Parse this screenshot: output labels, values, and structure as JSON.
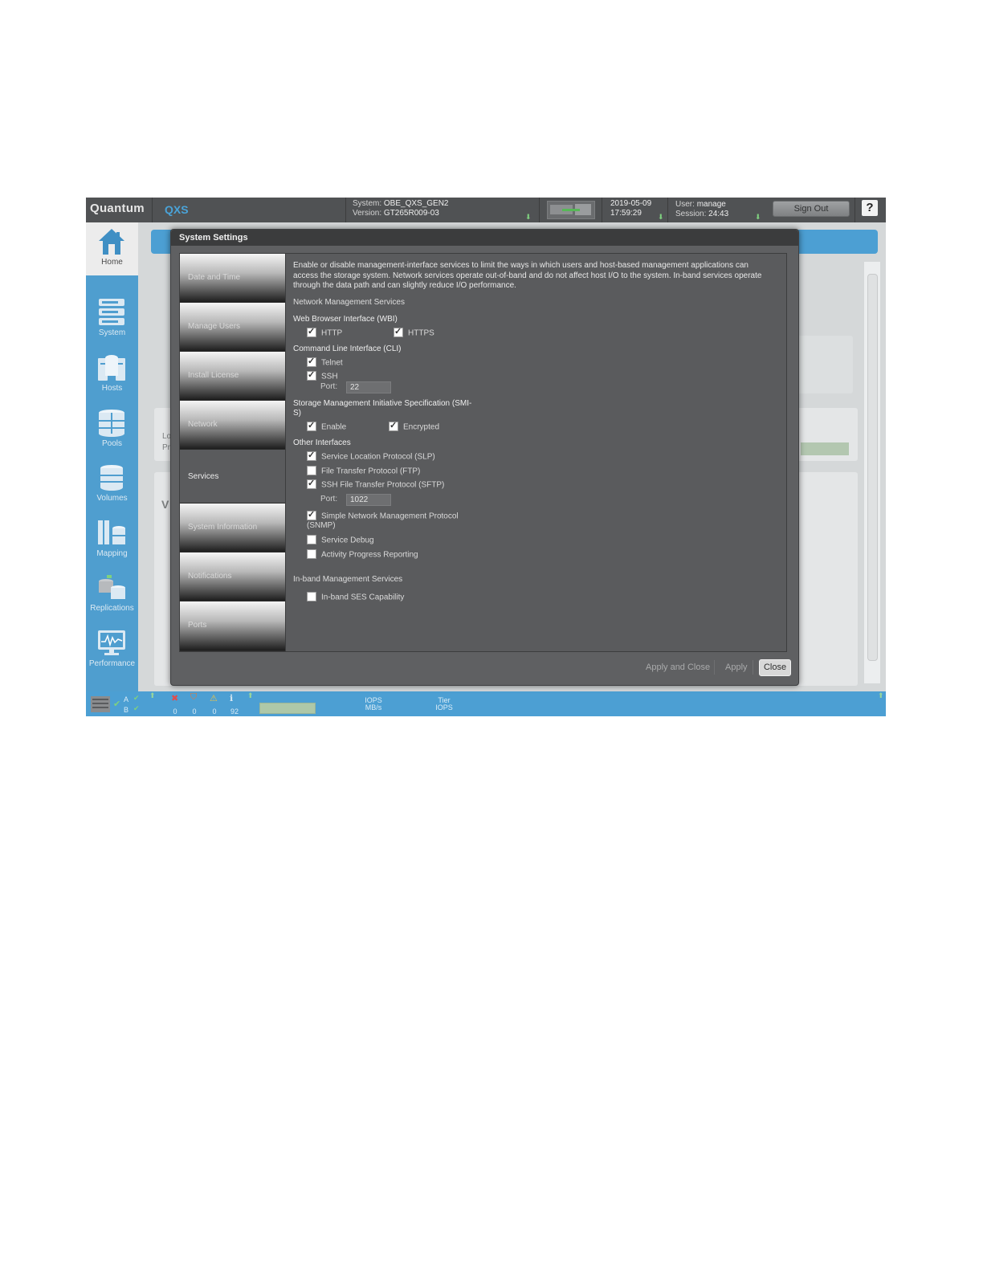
{
  "topbar": {
    "brand": "Quantum",
    "product": "QXS",
    "system_label": "System:",
    "system_name": "OBE_QXS_GEN2",
    "version_label": "Version:",
    "version": "GT265R009-03",
    "date": "2019-05-09",
    "time": "17:59:29",
    "user_label": "User:",
    "user": "manage",
    "session_label": "Session:",
    "session": "24:43",
    "sign_out": "Sign Out",
    "help": "?"
  },
  "sidenav": {
    "items": [
      {
        "label": "Home",
        "icon": "home-icon"
      },
      {
        "label": "System",
        "icon": "system-icon"
      },
      {
        "label": "Hosts",
        "icon": "hosts-icon"
      },
      {
        "label": "Pools",
        "icon": "pools-icon"
      },
      {
        "label": "Volumes",
        "icon": "volumes-icon"
      },
      {
        "label": "Mapping",
        "icon": "mapping-icon"
      },
      {
        "label": "Replications",
        "icon": "replications-icon"
      },
      {
        "label": "Performance",
        "icon": "performance-icon"
      }
    ]
  },
  "background": {
    "partial_1": "Lo",
    "partial_2": "Pr",
    "partial_3": "V"
  },
  "statusbar": {
    "controller_a": "A",
    "controller_b": "B",
    "critical_count": "0",
    "error_count": "0",
    "warning_count": "0",
    "info_count": "92",
    "iops_label": "IOPS",
    "mbs_label": "MB/s",
    "tier_label": "Tier",
    "tier_iops_label": "IOPS"
  },
  "modal": {
    "title": "System Settings",
    "tabs": [
      "Date and Time",
      "Manage Users",
      "Install License",
      "Network",
      "Services",
      "System Information",
      "Notifications",
      "Ports"
    ],
    "active_tab": "Services",
    "description": "Enable or disable management-interface services to limit the ways in which users and host-based management applications can access the storage system. Network services operate out-of-band and do not affect host I/O to the system. In-band services operate through the data path and can slightly reduce I/O performance.",
    "network_section": "Network Management Services",
    "wbi": {
      "title": "Web Browser Interface (WBI)",
      "http": {
        "label": "HTTP",
        "checked": true
      },
      "https": {
        "label": "HTTPS",
        "checked": true
      }
    },
    "cli": {
      "title": "Command Line Interface (CLI)",
      "telnet": {
        "label": "Telnet",
        "checked": true
      },
      "ssh": {
        "label": "SSH",
        "checked": true
      },
      "port_label": "Port:",
      "port": "22"
    },
    "smis": {
      "title_line1": "Storage Management Initiative Specification (SMI-",
      "title_line2": "S)",
      "enable": {
        "label": "Enable",
        "checked": true
      },
      "encrypted": {
        "label": "Encrypted",
        "checked": true
      }
    },
    "other": {
      "title": "Other Interfaces",
      "slp": {
        "label": "Service Location Protocol (SLP)",
        "checked": true
      },
      "ftp": {
        "label": "File Transfer Protocol (FTP)",
        "checked": false
      },
      "sftp": {
        "label": "SSH File Transfer Protocol (SFTP)",
        "checked": true
      },
      "sftp_port_label": "Port:",
      "sftp_port": "1022",
      "snmp_line1": "Simple Network Management Protocol",
      "snmp_line2": "(SNMP)",
      "snmp_checked": true,
      "debug": {
        "label": "Service Debug",
        "checked": false
      },
      "progress": {
        "label": "Activity Progress Reporting",
        "checked": false
      }
    },
    "inband_section": "In-band Management Services",
    "ses": {
      "label": "In-band SES Capability",
      "checked": false
    },
    "footer": {
      "apply_close": "Apply and Close",
      "apply": "Apply",
      "close": "Close"
    }
  },
  "colors": {
    "topbar": "#505254",
    "accent_blue": "#4c9fd3",
    "modal_bg": "#5f6062",
    "title_bar": "#3b3c3d"
  }
}
